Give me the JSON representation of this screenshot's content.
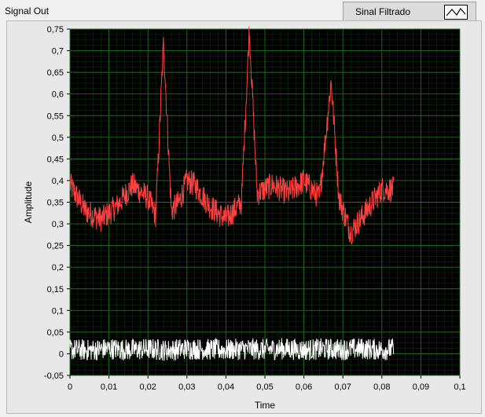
{
  "window": {
    "title": "Signal Out"
  },
  "legend": {
    "label": "Sinal Filtrado",
    "icon": "line-plot-icon"
  },
  "colors": {
    "plot_bg": "#000000",
    "grid": "#1f6e1f",
    "series1": "#ff4040",
    "series2": "#ffffff"
  },
  "chart_data": {
    "type": "line",
    "xlabel": "Time",
    "ylabel": "Amplitude",
    "xlim": [
      0,
      0.1
    ],
    "ylim": [
      -0.05,
      0.75
    ],
    "x_ticks": [
      "0",
      "0,01",
      "0,02",
      "0,03",
      "0,04",
      "0,05",
      "0,06",
      "0,07",
      "0,08",
      "0,09",
      "0,1"
    ],
    "y_ticks": [
      "-0,05",
      "0",
      "0,05",
      "0,1",
      "0,15",
      "0,2",
      "0,25",
      "0,3",
      "0,35",
      "0,4",
      "0,45",
      "0,5",
      "0,55",
      "0,6",
      "0,65",
      "0,7",
      "0,75"
    ],
    "grid": true,
    "series": [
      {
        "x": [
          0,
          0.004,
          0.008,
          0.012,
          0.016,
          0.02,
          0.022,
          0.024,
          0.026,
          0.028,
          0.03,
          0.032,
          0.036,
          0.04,
          0.044,
          0.046,
          0.048,
          0.052,
          0.056,
          0.06,
          0.064,
          0.067,
          0.069,
          0.072,
          0.076,
          0.08,
          0.083
        ],
        "y": [
          0.39,
          0.33,
          0.31,
          0.34,
          0.39,
          0.36,
          0.32,
          0.72,
          0.33,
          0.35,
          0.4,
          0.39,
          0.34,
          0.31,
          0.35,
          0.75,
          0.37,
          0.39,
          0.37,
          0.4,
          0.36,
          0.63,
          0.36,
          0.28,
          0.33,
          0.38,
          0.38
        ]
      },
      {
        "x": [
          0,
          0.005,
          0.01,
          0.015,
          0.02,
          0.025,
          0.03,
          0.035,
          0.04,
          0.045,
          0.05,
          0.055,
          0.06,
          0.065,
          0.07,
          0.075,
          0.08,
          0.083
        ],
        "y": [
          0.01,
          0.008,
          0.012,
          0.009,
          0.011,
          0.008,
          0.012,
          0.01,
          0.009,
          0.011,
          0.01,
          0.012,
          0.009,
          0.011,
          0.01,
          0.012,
          0.009,
          0.011
        ]
      }
    ]
  }
}
